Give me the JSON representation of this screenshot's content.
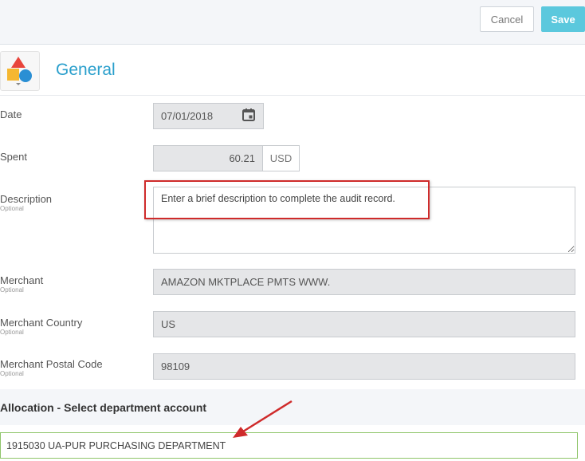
{
  "toolbar": {
    "cancel_label": "Cancel",
    "save_label": "Save"
  },
  "section": {
    "title": "General",
    "icon": "shapes-icon"
  },
  "fields": {
    "date": {
      "label": "Date",
      "value": "07/01/2018",
      "icon": "calendar-icon"
    },
    "spent": {
      "label": "Spent",
      "value": "60.21",
      "currency": "USD"
    },
    "description": {
      "label": "Description",
      "optional": "Optional",
      "value": "Enter a brief description to complete the audit record."
    },
    "merchant": {
      "label": "Merchant",
      "optional": "Optional",
      "value": "AMAZON MKTPLACE PMTS WWW."
    },
    "merchant_country": {
      "label": "Merchant Country",
      "optional": "Optional",
      "value": "US"
    },
    "merchant_postal_code": {
      "label": "Merchant Postal Code",
      "optional": "Optional",
      "value": "98109"
    }
  },
  "allocation": {
    "title": "Allocation - Select department account",
    "value": "1915030 UA-PUR PURCHASING DEPARTMENT"
  },
  "colors": {
    "accent": "#2a9fcc",
    "save_button": "#5bc8dd",
    "highlight": "#cf2b2b",
    "allocation_border": "#8fc56a"
  }
}
